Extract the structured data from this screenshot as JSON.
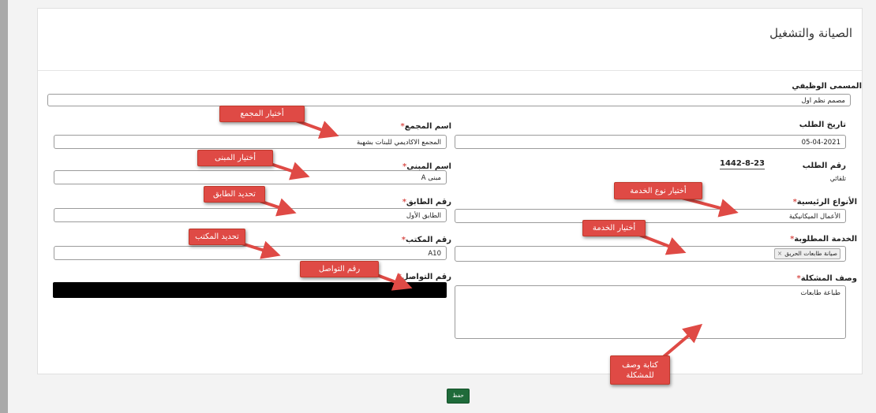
{
  "page_title": "الصيانة والتشغيل",
  "fields": {
    "job_title": {
      "label": "المسمى الوظيفي",
      "value": "مصمم نظم اول"
    },
    "request_date": {
      "label": "تاريخ الطلب",
      "value": "05-04-2021"
    },
    "complex_name": {
      "label": "اسم المجمع",
      "value": "المجمع الاكاديمي للبنات بشهبة"
    },
    "request_number": {
      "label": "رقم الطلب",
      "value": "1442-8-23",
      "status": "تلقائي"
    },
    "building_name": {
      "label": "اسم المبنى",
      "value": "مبنى A"
    },
    "main_types": {
      "label": "الأنواع الرئيسية",
      "value": "الأعمال الميكانيكية"
    },
    "floor_number": {
      "label": "رقم الطابق",
      "value": "الطابق الأول"
    },
    "requested_service": {
      "label": "الخدمة المطلوبة",
      "chip": "صيانة طابعات الحريق",
      "chip_remove": "×"
    },
    "office_number": {
      "label": "رقم المكتب",
      "value": "A10"
    },
    "problem_description": {
      "label": "وصف المشكلة",
      "value": "طباعة طابعات"
    },
    "contact_number": {
      "label": "رقم التواصل"
    }
  },
  "required_marker": "*",
  "callouts": {
    "choose_complex": "أختيار المجمع",
    "choose_building": "أختيار المبنى",
    "set_floor": "تحديد الطابق",
    "set_office": "تحديد المكتب",
    "contact_number": "رقم التواصل",
    "choose_service_type": "أختيار نوع الخدمة",
    "choose_service": "أختيار الخدمة",
    "write_problem": "كتابة وصف للمشكلة"
  },
  "save_button": "حفظ",
  "colors": {
    "callout": "#df4a45",
    "save": "#1f6b3a",
    "required": "#d9534f"
  }
}
